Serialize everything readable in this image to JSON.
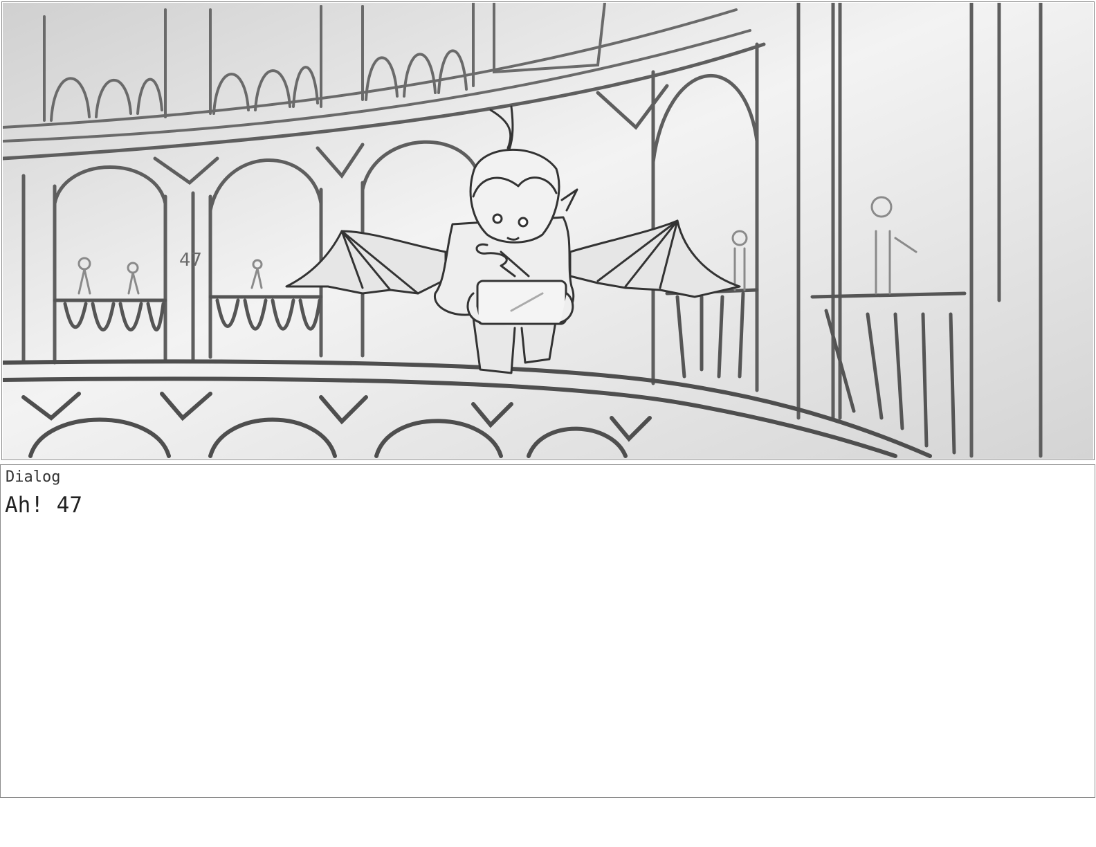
{
  "panel": {
    "sketch_number_label": "47",
    "style": "grayscale storyboard sketch",
    "background_gradient": [
      "#d2d2d2",
      "#f2f2f2",
      "#d6d6d6"
    ],
    "line_color": "#5e5e5e"
  },
  "dialog": {
    "label": "Dialog",
    "text": "Ah! 47"
  }
}
